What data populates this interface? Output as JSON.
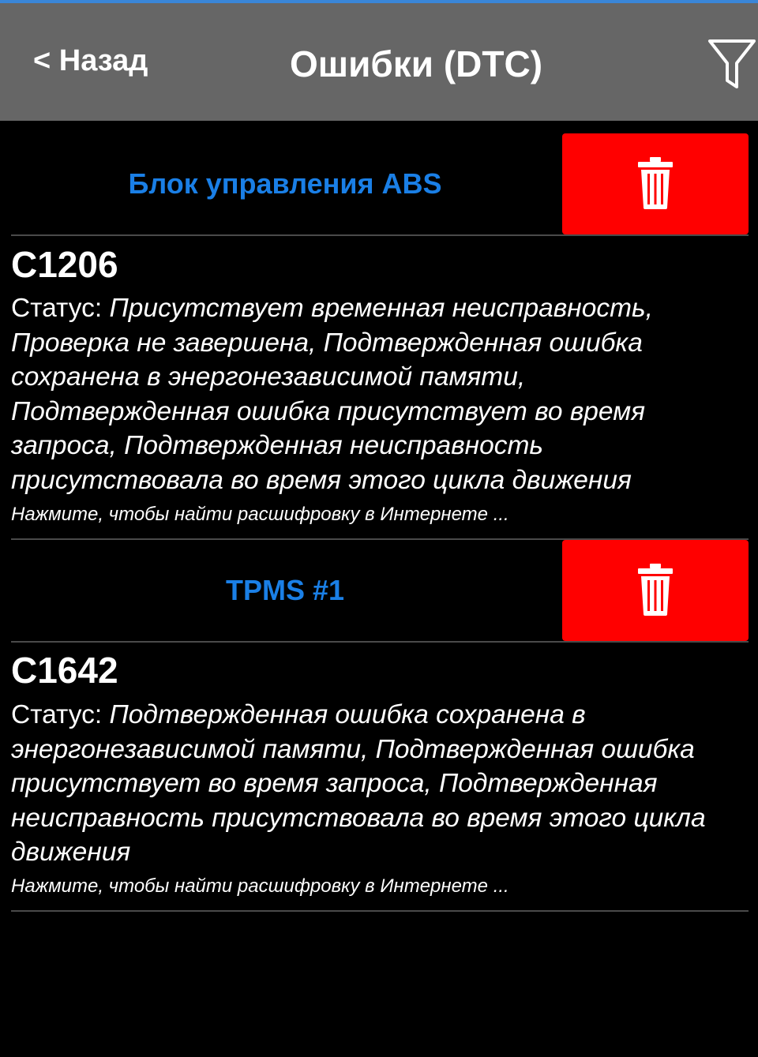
{
  "header": {
    "back_label": "< Назад",
    "title": "Ошибки (DTC)",
    "filter_icon": "filter-funnel-icon"
  },
  "colors": {
    "header_bg": "#666666",
    "accent_line": "#3a86d8",
    "module_title": "#1a7fe6",
    "delete_bg": "#ff0000",
    "background": "#000000"
  },
  "groups": [
    {
      "module": "Блок управления ABS",
      "delete_icon": "trash-icon",
      "code": "C1206",
      "status_label": "Статус:",
      "status_value": "Присутствует временная неисправность, Проверка не завершена, Подтвержденная ошибка сохранена в энергонезависимой памяти, Подтвержденная ошибка присутствует во время запроса, Подтвержденная неисправность присутствовала во время этого цикла движения",
      "hint": "Нажмите, чтобы найти расшифровку в Интернете ..."
    },
    {
      "module": "TPMS #1",
      "delete_icon": "trash-icon",
      "code": "C1642",
      "status_label": "Статус:",
      "status_value": "Подтвержденная ошибка сохранена в энергонезависимой памяти, Подтвержденная ошибка присутствует во время запроса, Подтвержденная неисправность присутствовала во время этого цикла движения",
      "hint": "Нажмите, чтобы найти расшифровку в Интернете ..."
    }
  ]
}
